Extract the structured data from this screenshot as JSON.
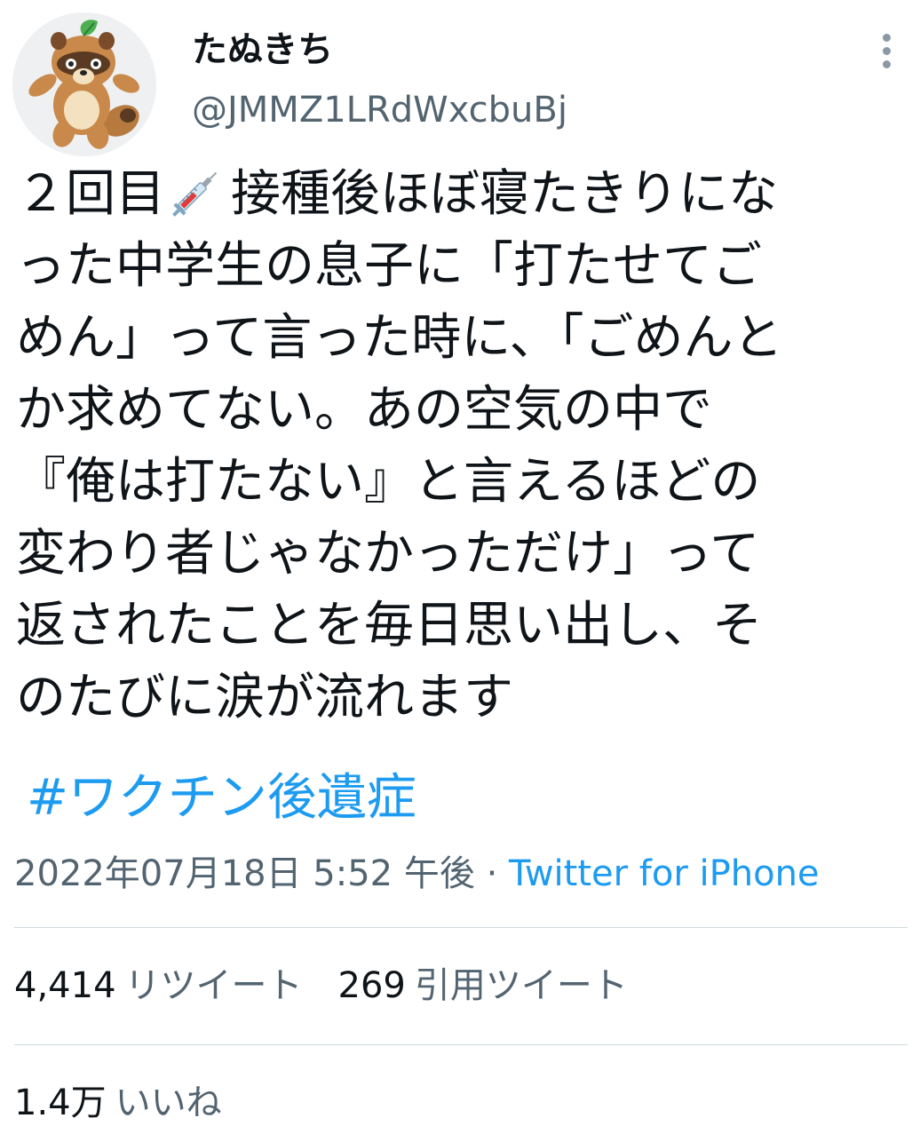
{
  "user": {
    "display_name": "たぬきち",
    "handle": "@JMMZ1LRdWxcbuBj",
    "avatar_icon": "tanuki-avatar-icon"
  },
  "tweet": {
    "line1_before": "２回目",
    "line1_after": "接種後ほぼ寝たきりにな",
    "syringe_icon": "syringe-emoji-icon",
    "lines": [
      "った中学生の息子に「打たせてご",
      "めん」って言った時に、「ごめんと",
      "か求めてない。あの空気の中で",
      "『俺は打たない』と言えるほどの",
      "変わり者じゃなかっただけ」って",
      "返されたことを毎日思い出し、そ",
      "のたびに涙が流れます"
    ],
    "hashtag": "#ワクチン後遺症"
  },
  "meta": {
    "timestamp": "2022年07月18日 5:52 午後",
    "separator": " · ",
    "source": "Twitter for iPhone"
  },
  "stats": {
    "retweets_count": "4,414",
    "retweets_label": "リツイート",
    "quotes_count": "269",
    "quotes_label": "引用ツイート",
    "likes_count": "1.4万",
    "likes_label": "いいね"
  },
  "colors": {
    "link": "#1d9bf0",
    "secondary_text": "#536471",
    "primary_text": "#0f1419",
    "divider": "#cfd9de"
  }
}
